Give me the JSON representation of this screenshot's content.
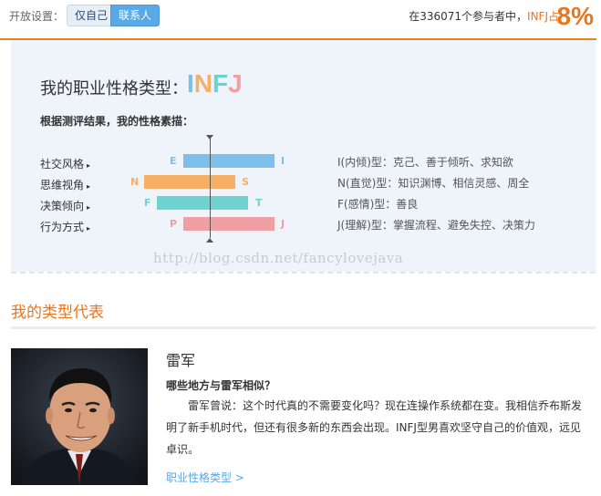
{
  "header": {
    "setting_label": "开放设置：",
    "option_private": "仅自己",
    "option_contacts": "联系人",
    "stat_prefix": "在336071个参与者中，",
    "stat_type": "INFJ占",
    "percent": "8%"
  },
  "result": {
    "title": "我的职业性格类型：",
    "type_letters": [
      {
        "char": "I",
        "color": "#7dbfe9"
      },
      {
        "char": "N",
        "color": "#f5b066"
      },
      {
        "char": "F",
        "color": "#6ed3cf"
      },
      {
        "char": "J",
        "color": "#f0a0a3"
      }
    ],
    "subtitle": "根据测评结果，我的性格素描：",
    "arrow_glyph": "▸",
    "dimensions": [
      {
        "label": "社交风格",
        "left": "E",
        "right": "I",
        "color": "#7dbfe9",
        "chosen": "I",
        "desc": "I(内倾)型：克己、善于倾听、求知欲"
      },
      {
        "label": "思维视角",
        "left": "N",
        "right": "S",
        "color": "#f5b066",
        "chosen": "N",
        "desc": "N(直觉)型：知识渊博、相信灵感、周全"
      },
      {
        "label": "决策倾向",
        "left": "F",
        "right": "T",
        "color": "#6ed3cf",
        "chosen": "F",
        "desc": "F(感情)型：善良"
      },
      {
        "label": "行为方式",
        "left": "P",
        "right": "J",
        "color": "#f0a0a3",
        "chosen": "J",
        "desc": "J(理解)型：掌握流程、避免失控、决策力"
      }
    ],
    "watermark": "http://blog.csdn.net/fancylovejava"
  },
  "representative": {
    "section_title": "我的类型代表",
    "name": "雷军",
    "question": "哪些地方与雷军相似？",
    "quote": "雷军曾说：这个时代真的不需要变化吗？现在连操作系统都在变。我相信乔布斯发明了新手机时代，但还有很多新的东西会出现。INFJ型男喜欢坚守自己的价值观，远见卓识。",
    "more_link": "职业性格类型 >"
  }
}
